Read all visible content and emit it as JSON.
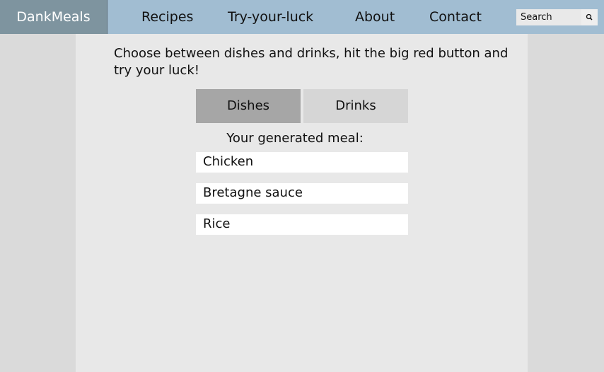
{
  "nav": {
    "brand": "DankMeals",
    "links": [
      "Recipes",
      "Try-your-luck",
      "About",
      "Contact"
    ],
    "search_placeholder": "Search",
    "search_icon": "search-icon"
  },
  "main": {
    "intro": "Choose between dishes and drinks, hit the big red button and try your luck!",
    "tabs": [
      {
        "label": "Dishes",
        "active": true
      },
      {
        "label": "Drinks",
        "active": false
      }
    ],
    "result_title": "Your generated meal:",
    "results": [
      "Chicken",
      "Bretagne sauce",
      "Rice"
    ]
  },
  "colors": {
    "navbar": "#a1bdd2",
    "brand_bg": "#7e949f",
    "tab_active": "#a6a6a6",
    "tab_inactive": "#d6d6d6",
    "page_bg": "#dadada",
    "content_bg": "#e8e8e8"
  }
}
